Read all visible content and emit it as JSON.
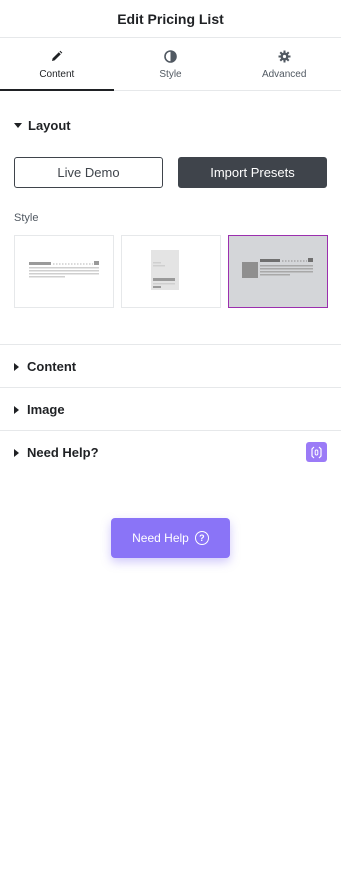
{
  "header": {
    "title": "Edit Pricing List"
  },
  "tabs": [
    {
      "label": "Content",
      "icon": "pencil-icon"
    },
    {
      "label": "Style",
      "icon": "half-circle-icon"
    },
    {
      "label": "Advanced",
      "icon": "gear-icon"
    }
  ],
  "layout": {
    "title": "Layout",
    "live_demo_label": "Live Demo",
    "import_presets_label": "Import Presets",
    "style_label": "Style",
    "presets": [
      "preset-1",
      "preset-2",
      "preset-3"
    ],
    "selected_preset_index": 2
  },
  "sections": [
    {
      "title": "Content"
    },
    {
      "title": "Image"
    },
    {
      "title": "Need Help?"
    }
  ],
  "floating": {
    "need_help_label": "Need Help",
    "question_mark": "?"
  },
  "colors": {
    "dark": "#3f444b",
    "accent_purple": "#8a74f7",
    "selected_border": "#9b2fae"
  }
}
